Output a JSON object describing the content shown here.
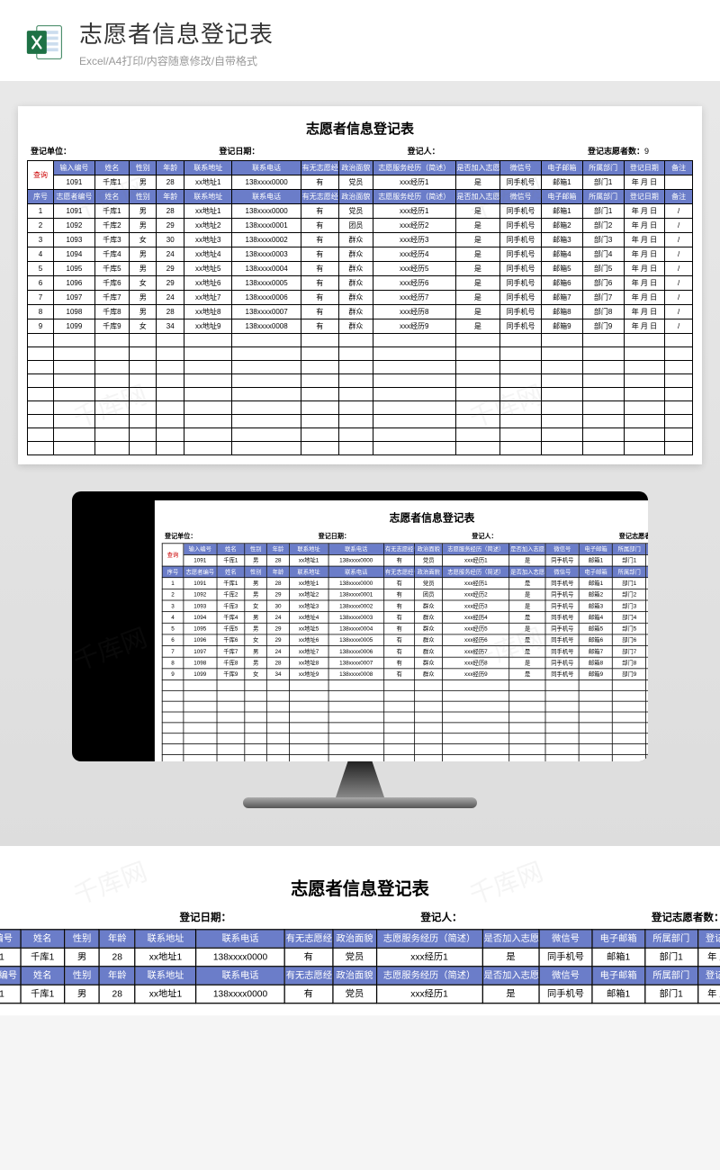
{
  "hero": {
    "title": "志愿者信息登记表",
    "subtitle": "Excel/A4打印/内容随意修改/自带格式"
  },
  "sheet": {
    "title": "志愿者信息登记表",
    "meta": {
      "unit_label": "登记单位：",
      "date_label": "登记日期：",
      "person_label": "登记人：",
      "count_label": "登记志愿者数：",
      "count_value": "9"
    },
    "query_label": "查询",
    "header1": [
      "输入编号",
      "姓名",
      "性别",
      "年龄",
      "联系地址",
      "联系电话",
      "有无志愿经验",
      "政治面貌",
      "志愿服务经历（简述）",
      "是否加入志愿者群",
      "微信号",
      "电子邮箱",
      "所属部门",
      "登记日期",
      "备注"
    ],
    "query_row": [
      "1091",
      "千库1",
      "男",
      "28",
      "xx地址1",
      "138xxxx0000",
      "有",
      "党员",
      "xxx经历1",
      "是",
      "同手机号",
      "邮箱1",
      "部门1",
      "年 月 日",
      ""
    ],
    "header2": [
      "序号",
      "志愿者编号",
      "姓名",
      "性别",
      "年龄",
      "联系地址",
      "联系电话",
      "有无志愿经验",
      "政治面貌",
      "志愿服务经历（简述）",
      "是否加入志愿者群",
      "微信号",
      "电子邮箱",
      "所属部门",
      "登记日期",
      "备注"
    ],
    "rows": [
      [
        "1",
        "1091",
        "千库1",
        "男",
        "28",
        "xx地址1",
        "138xxxx0000",
        "有",
        "党员",
        "xxx经历1",
        "是",
        "同手机号",
        "邮箱1",
        "部门1",
        "年 月 日",
        "/"
      ],
      [
        "2",
        "1092",
        "千库2",
        "男",
        "29",
        "xx地址2",
        "138xxxx0001",
        "有",
        "团员",
        "xxx经历2",
        "是",
        "同手机号",
        "邮箱2",
        "部门2",
        "年 月 日",
        "/"
      ],
      [
        "3",
        "1093",
        "千库3",
        "女",
        "30",
        "xx地址3",
        "138xxxx0002",
        "有",
        "群众",
        "xxx经历3",
        "是",
        "同手机号",
        "邮箱3",
        "部门3",
        "年 月 日",
        "/"
      ],
      [
        "4",
        "1094",
        "千库4",
        "男",
        "24",
        "xx地址4",
        "138xxxx0003",
        "有",
        "群众",
        "xxx经历4",
        "是",
        "同手机号",
        "邮箱4",
        "部门4",
        "年 月 日",
        "/"
      ],
      [
        "5",
        "1095",
        "千库5",
        "男",
        "29",
        "xx地址5",
        "138xxxx0004",
        "有",
        "群众",
        "xxx经历5",
        "是",
        "同手机号",
        "邮箱5",
        "部门5",
        "年 月 日",
        "/"
      ],
      [
        "6",
        "1096",
        "千库6",
        "女",
        "29",
        "xx地址6",
        "138xxxx0005",
        "有",
        "群众",
        "xxx经历6",
        "是",
        "同手机号",
        "邮箱6",
        "部门6",
        "年 月 日",
        "/"
      ],
      [
        "7",
        "1097",
        "千库7",
        "男",
        "24",
        "xx地址7",
        "138xxxx0006",
        "有",
        "群众",
        "xxx经历7",
        "是",
        "同手机号",
        "邮箱7",
        "部门7",
        "年 月 日",
        "/"
      ],
      [
        "8",
        "1098",
        "千库8",
        "男",
        "28",
        "xx地址8",
        "138xxxx0007",
        "有",
        "群众",
        "xxx经历8",
        "是",
        "同手机号",
        "邮箱8",
        "部门8",
        "年 月 日",
        "/"
      ],
      [
        "9",
        "1099",
        "千库9",
        "女",
        "34",
        "xx地址9",
        "138xxxx0008",
        "有",
        "群众",
        "xxx经历9",
        "是",
        "同手机号",
        "邮箱9",
        "部门9",
        "年 月 日",
        "/"
      ]
    ],
    "empty_rows": 9
  },
  "watermark_text": "千库网"
}
